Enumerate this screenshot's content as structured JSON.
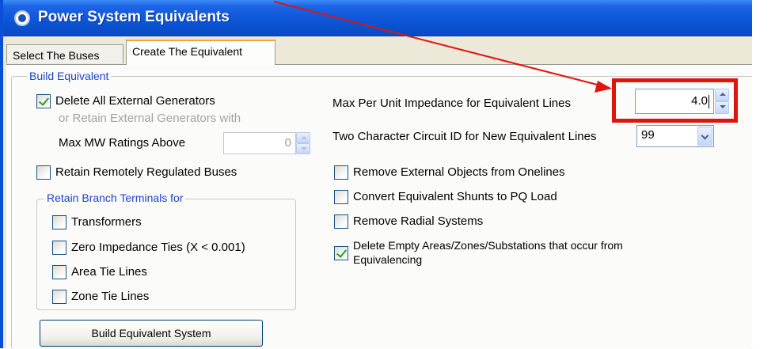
{
  "window": {
    "title": "Power System Equivalents"
  },
  "tabs": [
    {
      "label": "Select The Buses"
    },
    {
      "label": "Create The Equivalent"
    }
  ],
  "build_group": {
    "legend": "Build Equivalent",
    "delete_generators": {
      "label": "Delete All External Generators",
      "checked": true
    },
    "retain_hint": "or Retain External Generators with",
    "max_mw": {
      "label": "Max MW Ratings Above",
      "value": "0"
    },
    "retain_remote": {
      "label": "Retain Remotely Regulated Buses",
      "checked": false
    }
  },
  "branch_group": {
    "legend": "Retain Branch Terminals for",
    "items": [
      {
        "label": "Transformers",
        "checked": false
      },
      {
        "label": "Zero Impedance Ties (X < 0.001)",
        "checked": false
      },
      {
        "label": "Area Tie Lines",
        "checked": false
      },
      {
        "label": "Zone Tie Lines",
        "checked": false
      }
    ]
  },
  "build_button": "Build Equivalent System",
  "right": {
    "max_impedance": {
      "label": "Max Per Unit Impedance for Equivalent Lines",
      "value": "4.0"
    },
    "circuit_id": {
      "label": "Two Character Circuit ID for New Equivalent Lines",
      "value": "99"
    },
    "options": [
      {
        "label": "Remove External Objects from Onelines",
        "checked": false
      },
      {
        "label": "Convert Equivalent Shunts to PQ Load",
        "checked": false
      },
      {
        "label": "Remove Radial Systems",
        "checked": false
      },
      {
        "label": "Delete Empty Areas/Zones/Substations that occur from",
        "label2": "Equivalencing",
        "checked": true
      }
    ]
  },
  "annotation": {
    "color": "#e0140e"
  }
}
